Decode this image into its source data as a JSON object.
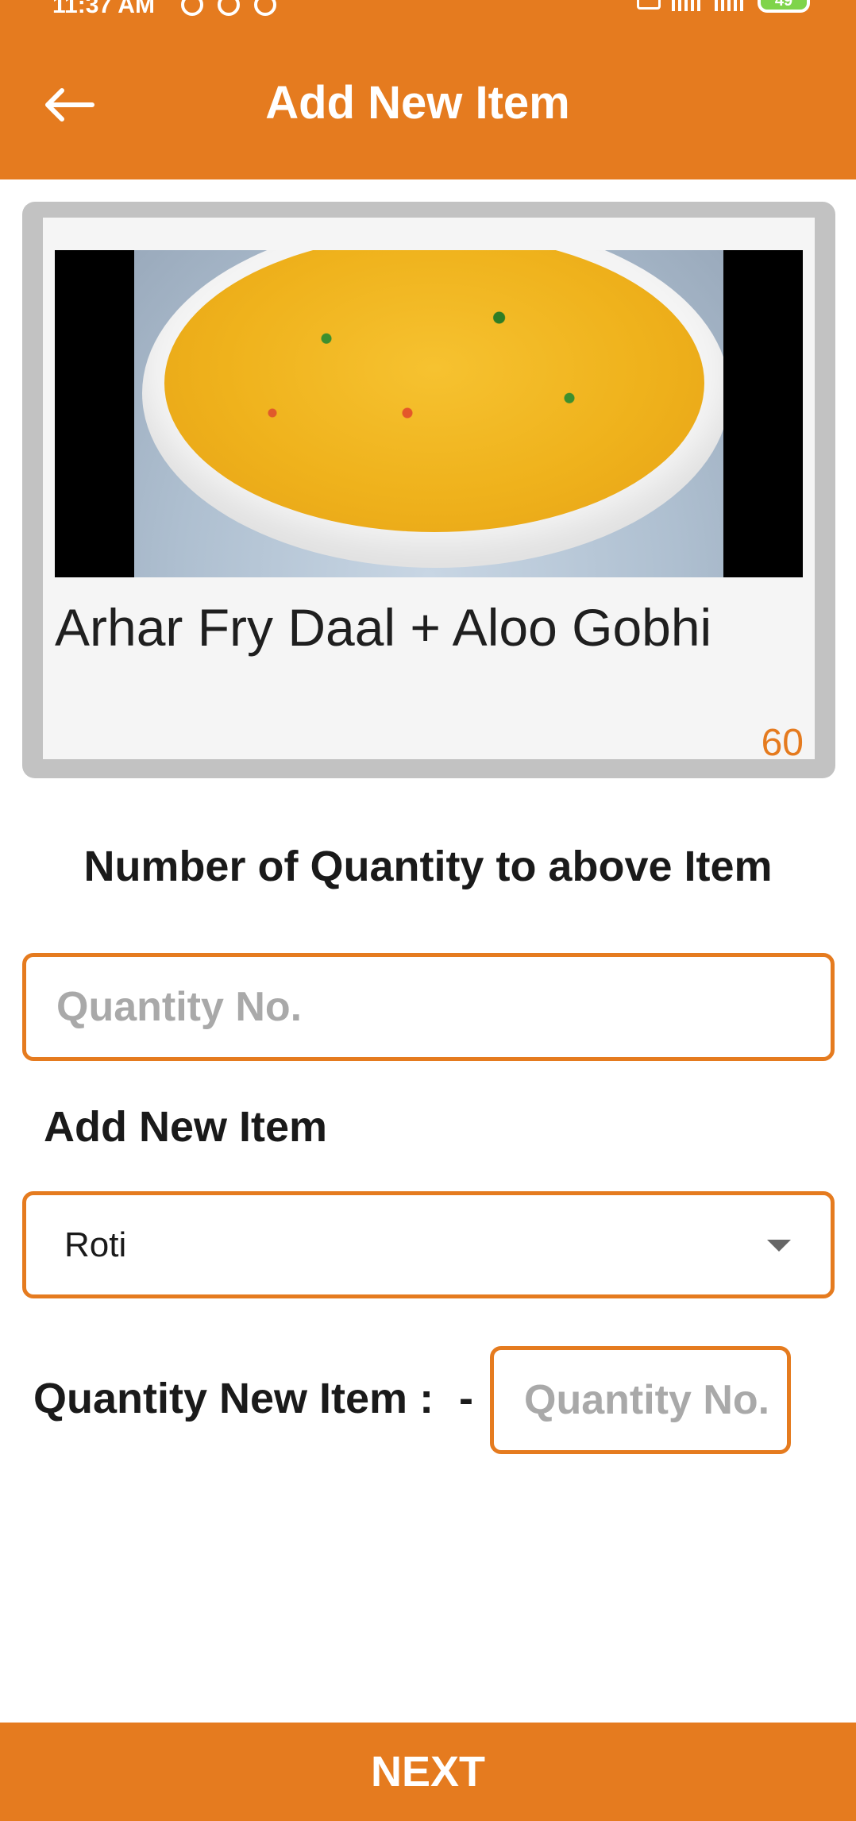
{
  "status_bar": {
    "time": "11:37 AM",
    "battery": "49"
  },
  "app_bar": {
    "title": "Add New Item",
    "back_icon": "arrow-left-icon"
  },
  "item_card": {
    "image_description_icon": "food-photo",
    "name": "Arhar Fry Daal + Aloo Gobhi",
    "price": "60"
  },
  "quantity_section": {
    "heading": "Number of Quantity to above Item",
    "placeholder": "Quantity No.",
    "value": ""
  },
  "add_item_section": {
    "label": "Add New Item",
    "selected": "Roti",
    "dropdown_icon": "triangle-down-icon"
  },
  "new_item_quantity": {
    "label": "Quantity New Item :",
    "separator": "-",
    "placeholder": "Quantity No.",
    "value": ""
  },
  "footer": {
    "next_label": "NEXT"
  },
  "colors": {
    "accent": "#E57B1F",
    "card_border": "#c2c2c2",
    "card_bg": "#f5f5f5",
    "placeholder": "#a9a9a9"
  }
}
